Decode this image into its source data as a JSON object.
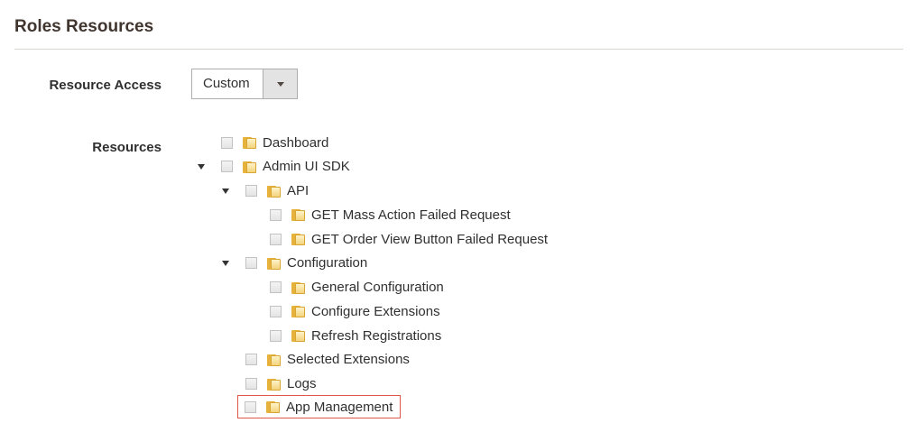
{
  "section": {
    "title": "Roles Resources"
  },
  "form": {
    "resource_access_label": "Resource Access",
    "resource_access_value": "Custom",
    "resources_label": "Resources"
  },
  "tree": [
    {
      "label": "Dashboard",
      "level": 0,
      "expanded": null,
      "highlighted": false
    },
    {
      "label": "Admin UI SDK",
      "level": 0,
      "expanded": true,
      "highlighted": false
    },
    {
      "label": "API",
      "level": 1,
      "expanded": true,
      "highlighted": false
    },
    {
      "label": "GET Mass Action Failed Request",
      "level": 2,
      "expanded": null,
      "highlighted": false
    },
    {
      "label": "GET Order View Button Failed Request",
      "level": 2,
      "expanded": null,
      "highlighted": false
    },
    {
      "label": "Configuration",
      "level": 1,
      "expanded": true,
      "highlighted": false
    },
    {
      "label": "General Configuration",
      "level": 2,
      "expanded": null,
      "highlighted": false
    },
    {
      "label": "Configure Extensions",
      "level": 2,
      "expanded": null,
      "highlighted": false
    },
    {
      "label": "Refresh Registrations",
      "level": 2,
      "expanded": null,
      "highlighted": false
    },
    {
      "label": "Selected Extensions",
      "level": 1,
      "expanded": null,
      "highlighted": false
    },
    {
      "label": "Logs",
      "level": 1,
      "expanded": null,
      "highlighted": false
    },
    {
      "label": "App Management",
      "level": 1,
      "expanded": null,
      "highlighted": true
    }
  ],
  "colors": {
    "highlight_border": "#e0574a",
    "folder": "#e7b23c",
    "divider": "#d9d6cf"
  }
}
